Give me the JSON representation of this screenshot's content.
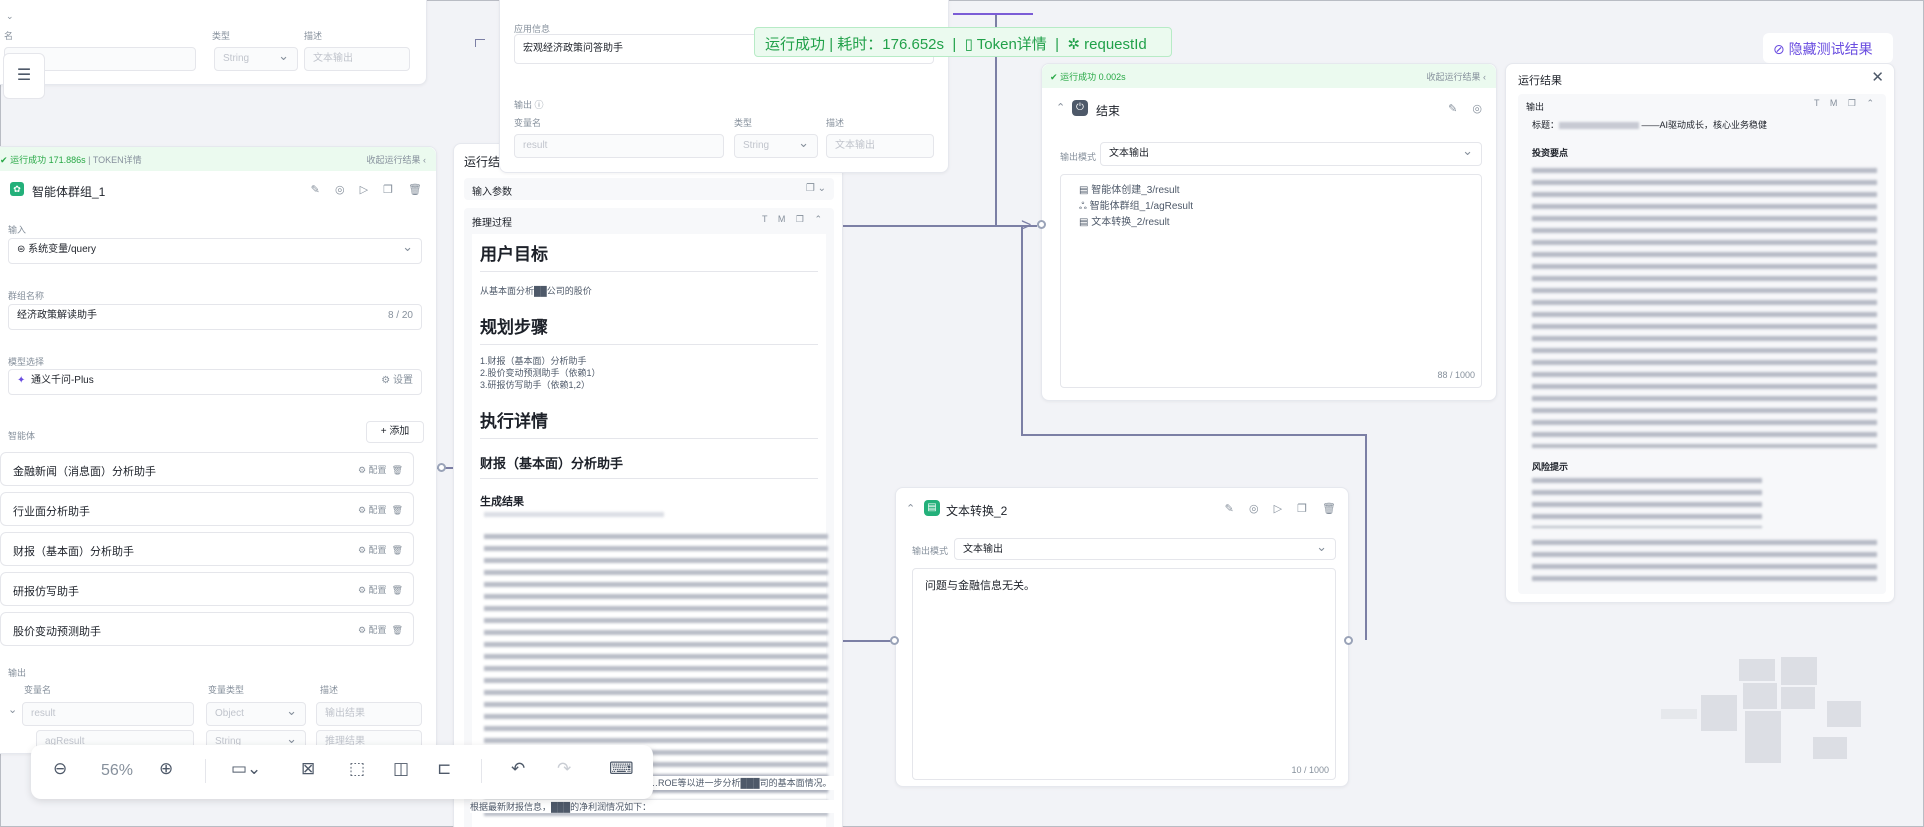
{
  "banner": {
    "status": "运行成功",
    "elapsed_label": "耗时：",
    "elapsed": "176.652s",
    "sep": "|",
    "token_link": "Token详情",
    "request_link": "requestId"
  },
  "hide_results_button": "隐藏测试结果",
  "top_left_node": {
    "col_name": "名",
    "col_type": "类型",
    "col_desc": "描述",
    "type_value": "String",
    "desc_placeholder": "文本输出"
  },
  "app_node": {
    "field_label": "应用信息",
    "app_name": "宏观经济政策问答助手",
    "output_label": "输出",
    "col_name": "变量名",
    "col_type": "类型",
    "col_desc": "描述",
    "name_value": "result",
    "type_value": "String",
    "desc_placeholder": "文本输出"
  },
  "agent_group": {
    "status": "运行成功 171.886s",
    "token": "TOKEN详情",
    "collapse": "收起运行结果",
    "title": "智能体群组_1",
    "input_label": "输入",
    "input_value": "系统变量/query",
    "group_name_label": "群组名称",
    "group_name": "经济政策解读助手",
    "group_name_count": "8 / 20",
    "model_label": "模型选择",
    "model_value": "通义千问-Plus",
    "model_settings": "设置",
    "agents_label": "智能体",
    "add_button": "添加",
    "agents": [
      {
        "name": "金融新闻（消息面）分析助手",
        "config": "配置"
      },
      {
        "name": "行业面分析助手",
        "config": "配置"
      },
      {
        "name": "财报（基本面）分析助手",
        "config": "配置"
      },
      {
        "name": "研报仿写助手",
        "config": "配置"
      },
      {
        "name": "股价变动预测助手",
        "config": "配置"
      }
    ],
    "output_label": "输出",
    "col_name": "变量名",
    "col_type": "变量类型",
    "col_desc": "描述",
    "rows": [
      {
        "name": "result",
        "type": "Object",
        "desc": "输出结果"
      },
      {
        "name": "agResult",
        "type": "String",
        "desc": "推理结果"
      }
    ]
  },
  "run_panel_mid": {
    "title": "运行结",
    "input_params": "输入参数",
    "reasoning": "推理过程",
    "tool_t": "T",
    "tool_m": "M",
    "h_goal": "用户目标",
    "goal_text": "从基本面分析██公司的股价",
    "h_steps": "规划步骤",
    "steps": [
      "1.财报（基本面）分析助手",
      "2.股价变动预测助手（依赖1）",
      "3.研报仿写助手（依赖1,2）"
    ],
    "h_exec": "执行详情",
    "h_sub": "财报（基本面）分析助手",
    "h_gen": "生成结果",
    "tail_1": "……ROE等以进一步分析███司的基本面情况。",
    "tail_2": "根据最新财报信息，███的净利润情况如下："
  },
  "end_node": {
    "status": "运行成功 0.002s",
    "collapse": "收起运行结果",
    "title": "结束",
    "mode_label": "输出模式",
    "mode_value": "文本输出",
    "vars": [
      "智能体创建_3/result",
      "智能体群组_1/agResult",
      "文本转换_2/result"
    ],
    "count": "88 / 1000"
  },
  "text_node": {
    "title": "文本转换_2",
    "mode_label": "输出模式",
    "mode_value": "文本输出",
    "content": "问题与金融信息无关。",
    "count": "10 / 1000"
  },
  "result_panel": {
    "title": "运行结果",
    "output_label": "输出",
    "tool_t": "T",
    "tool_m": "M",
    "headline_prefix": "标题：",
    "headline_suffix": "——AI驱动成长，核心业务稳健",
    "section_1": "投资要点",
    "section_2": "风险提示"
  },
  "toolbar": {
    "zoom": "56%"
  }
}
